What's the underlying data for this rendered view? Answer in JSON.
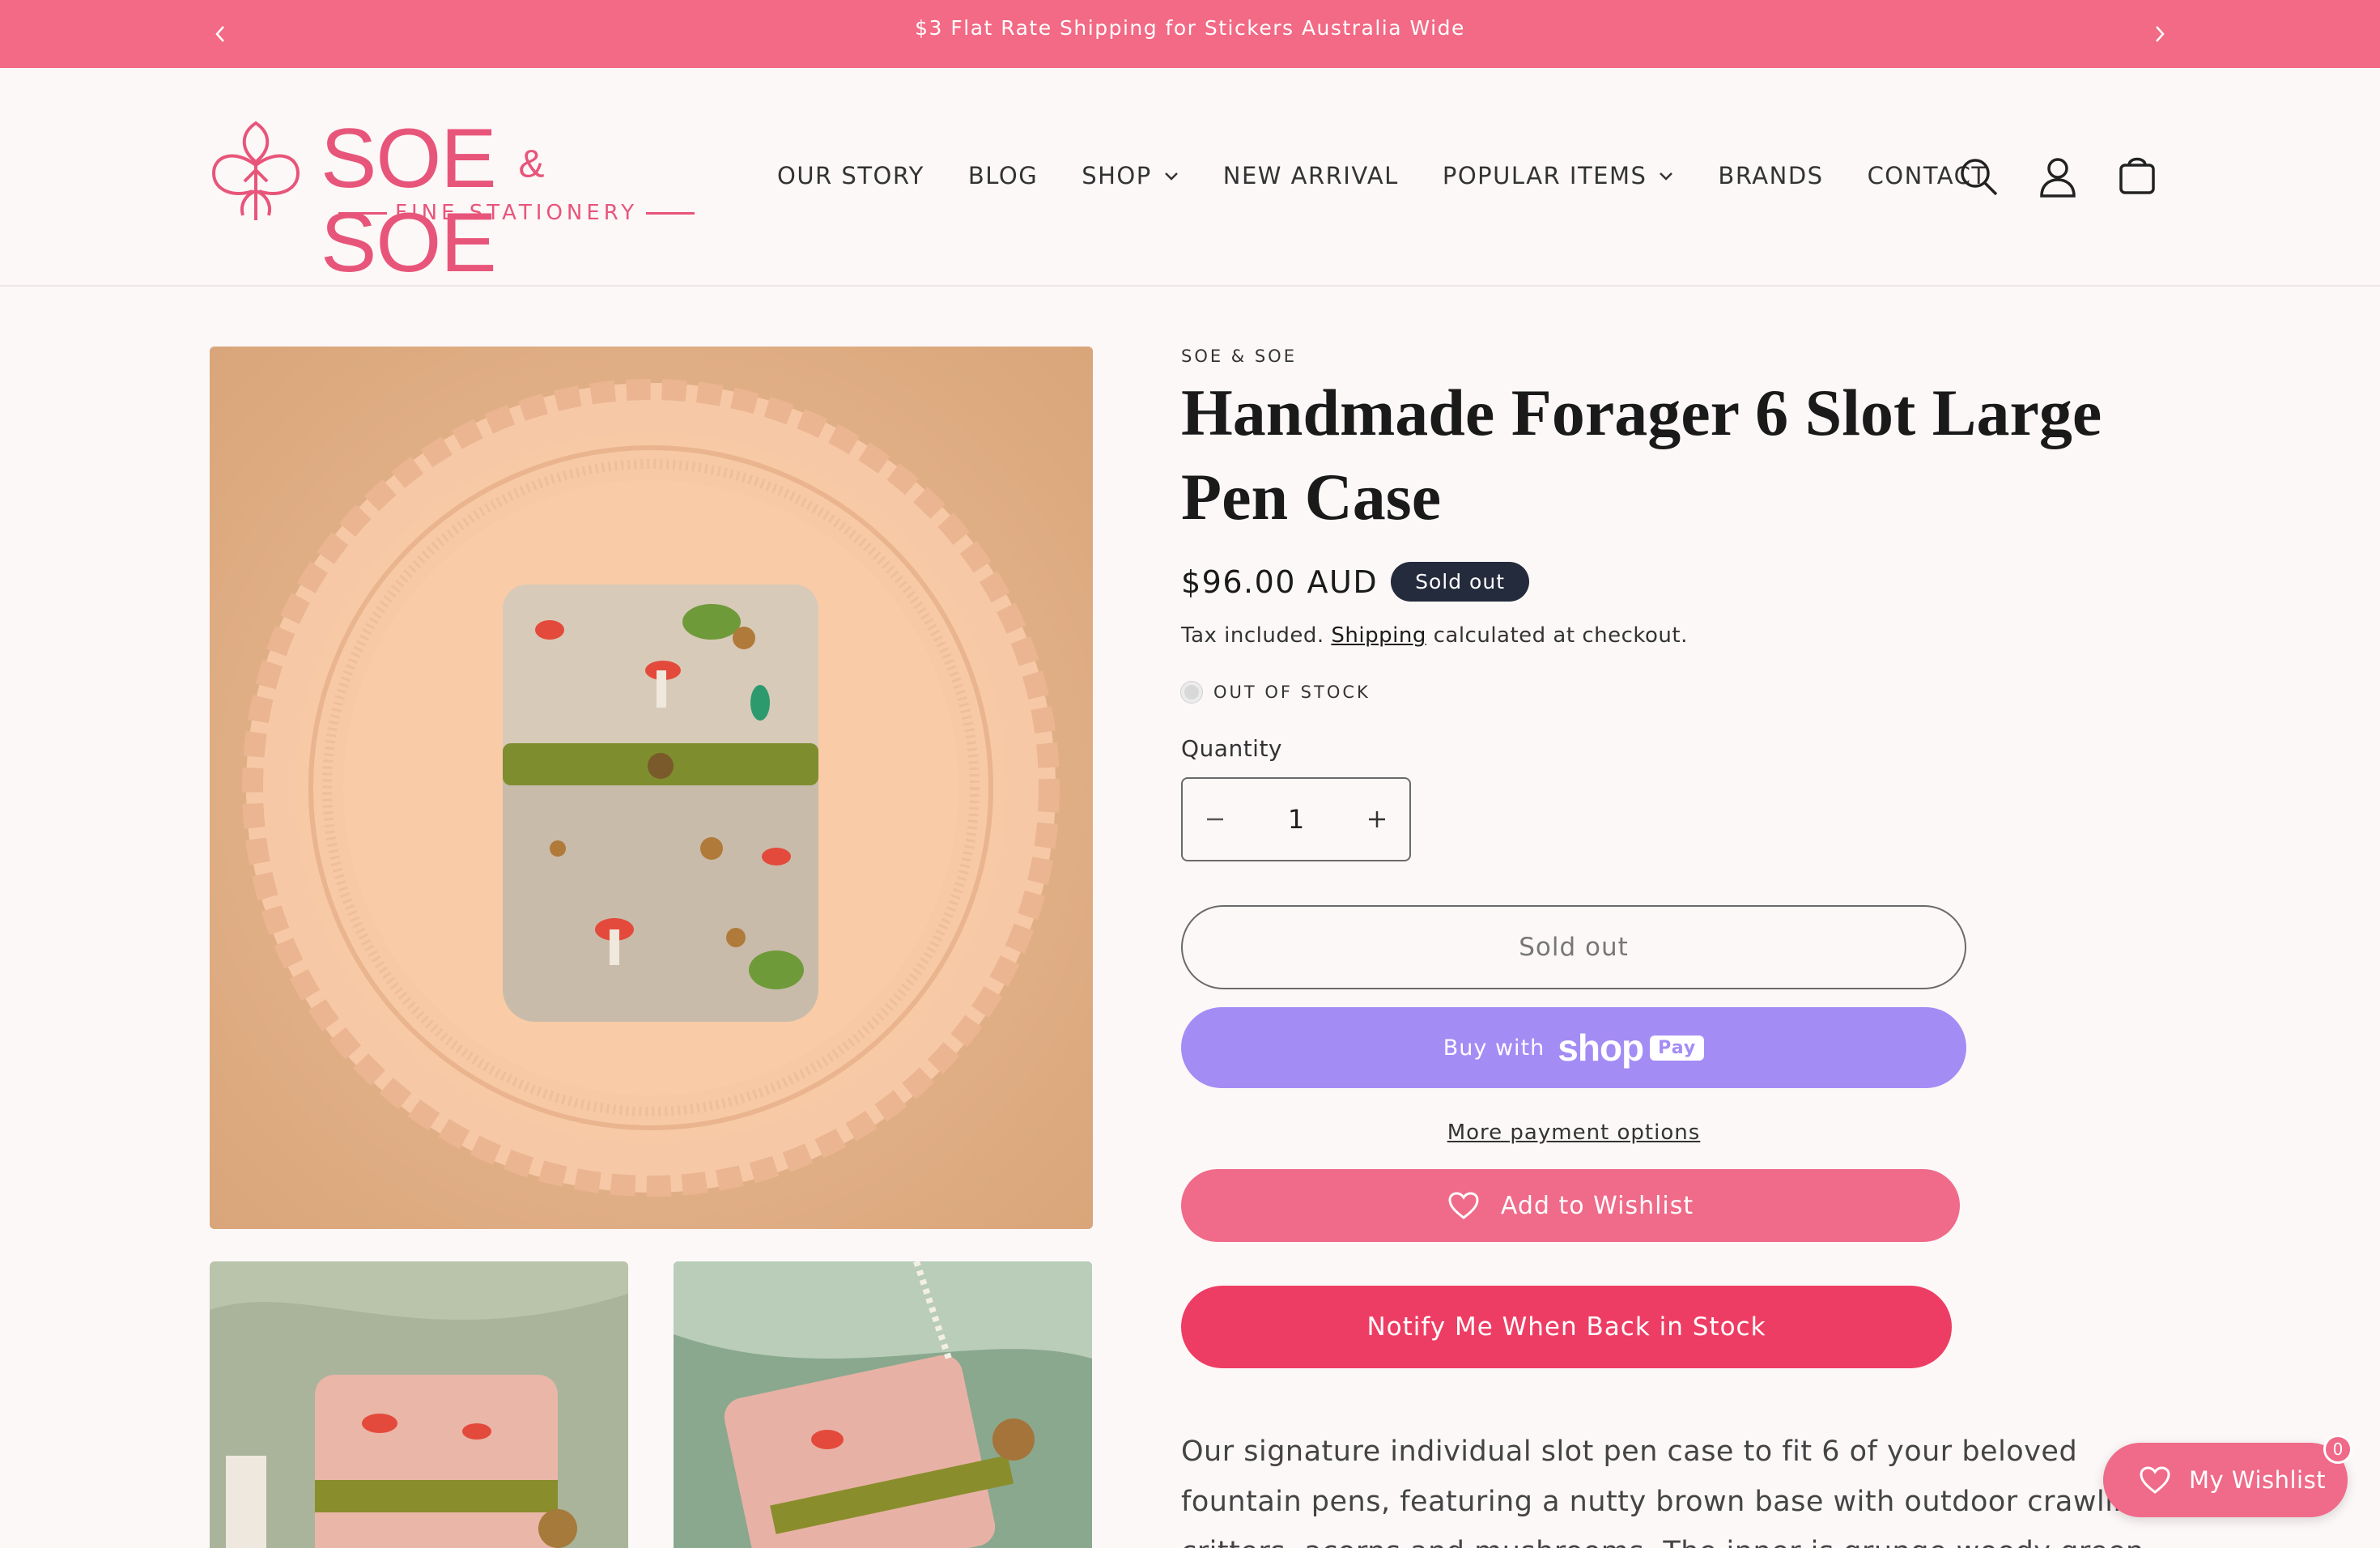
{
  "announcement": {
    "message": "$3 Flat Rate Shipping for Stickers Australia Wide"
  },
  "brand": {
    "logo_main": "SOE",
    "logo_amp": "&",
    "logo_main2": "SOE",
    "logo_sub": "FINE STATIONERY",
    "color": "#e8557a"
  },
  "nav": {
    "items": [
      {
        "label": "OUR STORY",
        "dropdown": false
      },
      {
        "label": "BLOG",
        "dropdown": false
      },
      {
        "label": "SHOP",
        "dropdown": true
      },
      {
        "label": "NEW ARRIVAL",
        "dropdown": false
      },
      {
        "label": "POPULAR ITEMS",
        "dropdown": true
      },
      {
        "label": "BRANDS",
        "dropdown": false
      },
      {
        "label": "CONTACT",
        "dropdown": false
      }
    ]
  },
  "header_icons": [
    "search-icon",
    "account-icon",
    "cart-icon"
  ],
  "product": {
    "vendor": "SOE & SOE",
    "title": "Handmade Forager 6 Slot Large Pen Case",
    "price": "$96.00 AUD",
    "badge": "Sold out",
    "tax_before": "Tax included.",
    "tax_link": "Shipping",
    "tax_after": "calculated at checkout.",
    "stock_status": "OUT OF STOCK",
    "quantity_label": "Quantity",
    "quantity_value": "1",
    "description": "Our signature individual slot pen case to fit 6 of your beloved fountain pens, featuring a nutty brown base with outdoor crawling critters, acorns and mushrooms. The inner is grunge woody green and finished with a brass rose."
  },
  "buttons": {
    "sold_out": "Sold out",
    "buy_with": "Buy with",
    "shop_logo": "shop",
    "shop_pay": "Pay",
    "more_payment": "More payment options",
    "add_wishlist": "Add to Wishlist",
    "notify": "Notify Me When Back in Stock"
  },
  "floating_wishlist": {
    "label": "My Wishlist",
    "count": "0"
  },
  "colors": {
    "announcement_bg": "#f26a85",
    "shop_pay": "#a48cf5",
    "wishlist": "#f06a89",
    "notify": "#ee3d64",
    "badge": "#232b3c"
  }
}
